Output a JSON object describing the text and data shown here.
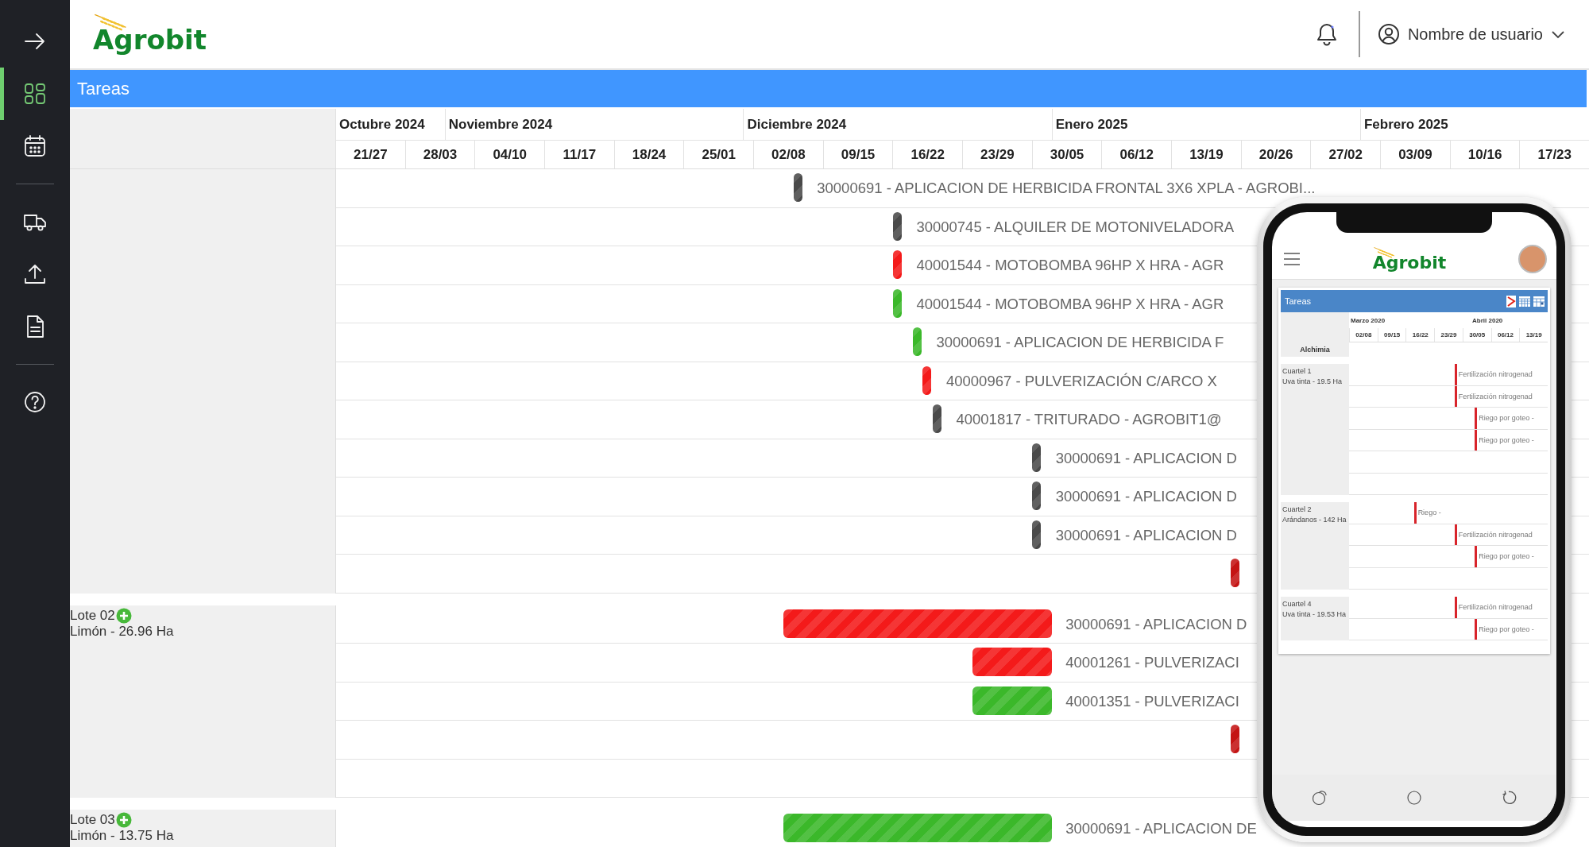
{
  "sidebar": {
    "items": [
      {
        "selected": false
      },
      {
        "selected": true
      },
      {
        "selected": false
      },
      {
        "selected": false
      },
      {
        "selected": false
      },
      {
        "selected": false
      },
      {
        "selected": false
      }
    ]
  },
  "header": {
    "logo": "Agrobit",
    "user_name": "Nombre de usuario"
  },
  "panel": {
    "title": "Tareas"
  },
  "gantt": {
    "months": [
      "Octubre 2024",
      "Noviembre 2024",
      "Diciembre 2024",
      "Enero 2025",
      "Febrero 2025"
    ],
    "weeks": [
      "21/27",
      "28/03",
      "04/10",
      "11/17",
      "18/24",
      "25/01",
      "02/08",
      "09/15",
      "16/22",
      "23/29",
      "30/05",
      "06/12",
      "13/19",
      "20/26",
      "27/02",
      "03/09",
      "10/16",
      "17/23"
    ],
    "groups": [
      {
        "rows": [
          {
            "kind": "task",
            "task": "30000691 - APLICACION DE HERBICIDA FRONTAL 3X6 XPLA - AGROBI...",
            "color": "#4a4a4a"
          },
          {
            "kind": "task",
            "task": "30000745 - ALQUILER DE MOTONIVELADORA",
            "color": "#4a4a4a"
          },
          {
            "kind": "task",
            "task": "40001544 - MOTOBOMBA 96HP X HRA - AGR",
            "color": "#f41a1a"
          },
          {
            "kind": "task",
            "task": "40001544 - MOTOBOMBA 96HP X HRA - AGR",
            "color": "#3bb82a"
          },
          {
            "kind": "task",
            "task": "30000691 - APLICACION DE HERBICIDA F",
            "color": "#3bb82a"
          },
          {
            "kind": "task",
            "task": "40000967 - PULVERIZACIÓN C/ARCO X",
            "color": "#f41a1a"
          },
          {
            "kind": "task",
            "task": "40001817 - TRITURADO - AGROBIT1@",
            "color": "#4a4a4a"
          },
          {
            "kind": "task",
            "task": "30000691 - APLICACION D",
            "color": "#4a4a4a"
          },
          {
            "kind": "task",
            "task": "30000691 - APLICACION D",
            "color": "#4a4a4a"
          },
          {
            "kind": "task",
            "task": "30000691 - APLICACION D",
            "color": "#4a4a4a"
          },
          {
            "kind": "bar",
            "color": "#c41414"
          }
        ]
      },
      {
        "name": "Lote 02",
        "crop": "Limón - 26.96 Ha",
        "rows": [
          {
            "kind": "task",
            "task": "30000691 - APLICACION D",
            "color": "#f41a1a"
          },
          {
            "kind": "task",
            "task": "40001261 - PULVERIZACI",
            "color": "#f41a1a"
          },
          {
            "kind": "task",
            "task": "40001351 - PULVERIZACI",
            "color": "#3bb82a"
          },
          {
            "kind": "bar",
            "color": "#c41414"
          },
          {
            "kind": "empty"
          }
        ]
      },
      {
        "name": "Lote 03",
        "crop": "Limón - 13.75 Ha",
        "rows": [
          {
            "kind": "task",
            "task": "30000691 - APLICACION DE",
            "color": "#3bb82a"
          }
        ]
      }
    ]
  },
  "phone": {
    "logo": "Agrobit",
    "panel_title": "Tareas",
    "months": [
      "Marzo 2020",
      "Abril 2020"
    ],
    "weeks": [
      "02/08",
      "09/15",
      "16/22",
      "23/29",
      "30/05",
      "06/12",
      "13/19"
    ],
    "farm": "Alchimia",
    "groups": [
      {
        "name": "Cuartel 1",
        "crop": "Uva tinta - 19.5 Ha",
        "rows": [
          {
            "kind": "task",
            "task": "Fertilización nitrogenad",
            "color": "#d8242b"
          },
          {
            "kind": "task",
            "task": "Fertilización nitrogenad",
            "color": "#d8242b"
          },
          {
            "kind": "task",
            "task": "Riego por goteo -",
            "color": "#d8242b"
          },
          {
            "kind": "task",
            "task": "Riego por goteo -",
            "color": "#d8242b"
          },
          {
            "kind": "empty"
          },
          {
            "kind": "empty"
          }
        ]
      },
      {
        "name": "Cuartel 2",
        "crop": "Arándanos - 142 Ha",
        "rows": [
          {
            "kind": "task",
            "task": "Riego -",
            "color": "#d8242b"
          },
          {
            "kind": "task",
            "task": "Fertilización nitrogenad",
            "color": "#d8242b"
          },
          {
            "kind": "task",
            "task": "Riego por goteo -",
            "color": "#d8242b"
          },
          {
            "kind": "empty"
          }
        ]
      },
      {
        "name": "Cuartel 4",
        "crop": "Uva tinta - 19.53 Ha",
        "rows": [
          {
            "kind": "task",
            "task": "Fertilización nitrogenad",
            "color": "#d8242b"
          },
          {
            "kind": "task",
            "task": "Riego por goteo -",
            "color": "#d8242b"
          }
        ]
      }
    ]
  }
}
